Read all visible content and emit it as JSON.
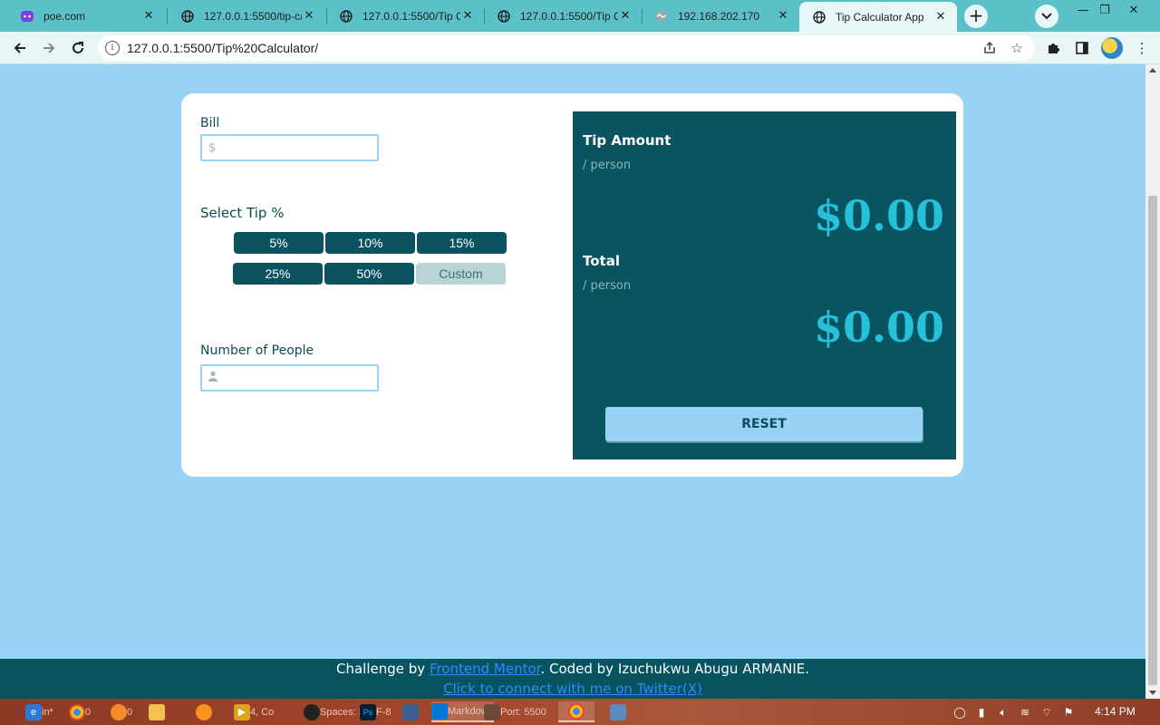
{
  "browser": {
    "tabs": [
      {
        "title": "poe.com",
        "icon": "poe-icon"
      },
      {
        "title": "127.0.0.1:5500/tip-ca",
        "icon": "globe-icon"
      },
      {
        "title": "127.0.0.1:5500/Tip Ca",
        "icon": "globe-icon"
      },
      {
        "title": "127.0.0.1:5500/Tip Ca",
        "icon": "globe-icon"
      },
      {
        "title": "192.168.202.170",
        "icon": "broken-page-icon"
      },
      {
        "title": "Tip Calculator App",
        "icon": "globe-icon",
        "active": true
      }
    ],
    "url": "127.0.0.1:5500/Tip%20Calculator/"
  },
  "calculator": {
    "bill_label": "Bill",
    "bill_icon": "$",
    "bill_value": "",
    "tip_label": "Select Tip %",
    "tip_options": [
      "5%",
      "10%",
      "15%",
      "25%",
      "50%"
    ],
    "custom_placeholder": "Custom",
    "people_label": "Number of People",
    "people_value": "",
    "results": {
      "tip_title": "Tip Amount",
      "tip_sub": "/ person",
      "tip_value": "$0.00",
      "total_title": "Total",
      "total_sub": "/ person",
      "total_value": "$0.00",
      "reset_label": "RESET"
    }
  },
  "footer": {
    "prefix": "Challenge by ",
    "link1": "Frontend Mentor",
    "middle": ". Coded by Izuchukwu Abugu ARMANIE.",
    "link2": "Click to connect with me on Twitter(X)"
  },
  "taskbar": {
    "items": [
      {
        "label": "in*",
        "icon": "edge-icon"
      },
      {
        "label": "0",
        "icon": "chrome-icon"
      },
      {
        "label": "0",
        "icon": "firefox-icon"
      },
      {
        "label": "",
        "icon": "folder-icon"
      },
      {
        "label": "",
        "icon": "fl-studio-icon"
      },
      {
        "label": "4, Co",
        "icon": "media-player-icon"
      },
      {
        "label": "Spaces: 2",
        "icon": "spaces-icon"
      },
      {
        "label": "F-8",
        "icon": "photoshop-icon"
      },
      {
        "label": "",
        "icon": "notepad-icon"
      },
      {
        "label": "Markdown",
        "icon": "vscode-icon"
      },
      {
        "label": "Port: 5500",
        "icon": "live-server-icon"
      },
      {
        "label": "",
        "icon": "chrome-active-icon"
      },
      {
        "label": "",
        "icon": "window-icon"
      }
    ],
    "clock": "4:14 PM"
  },
  "colors": {
    "page_bg": "#98d2f4",
    "card_bg": "#ffffff",
    "result_bg": "#085460",
    "accent": "#26c0d9",
    "tip_button_bg": "#0b5360",
    "footer_bg": "#075360",
    "link": "#2b8cff"
  }
}
